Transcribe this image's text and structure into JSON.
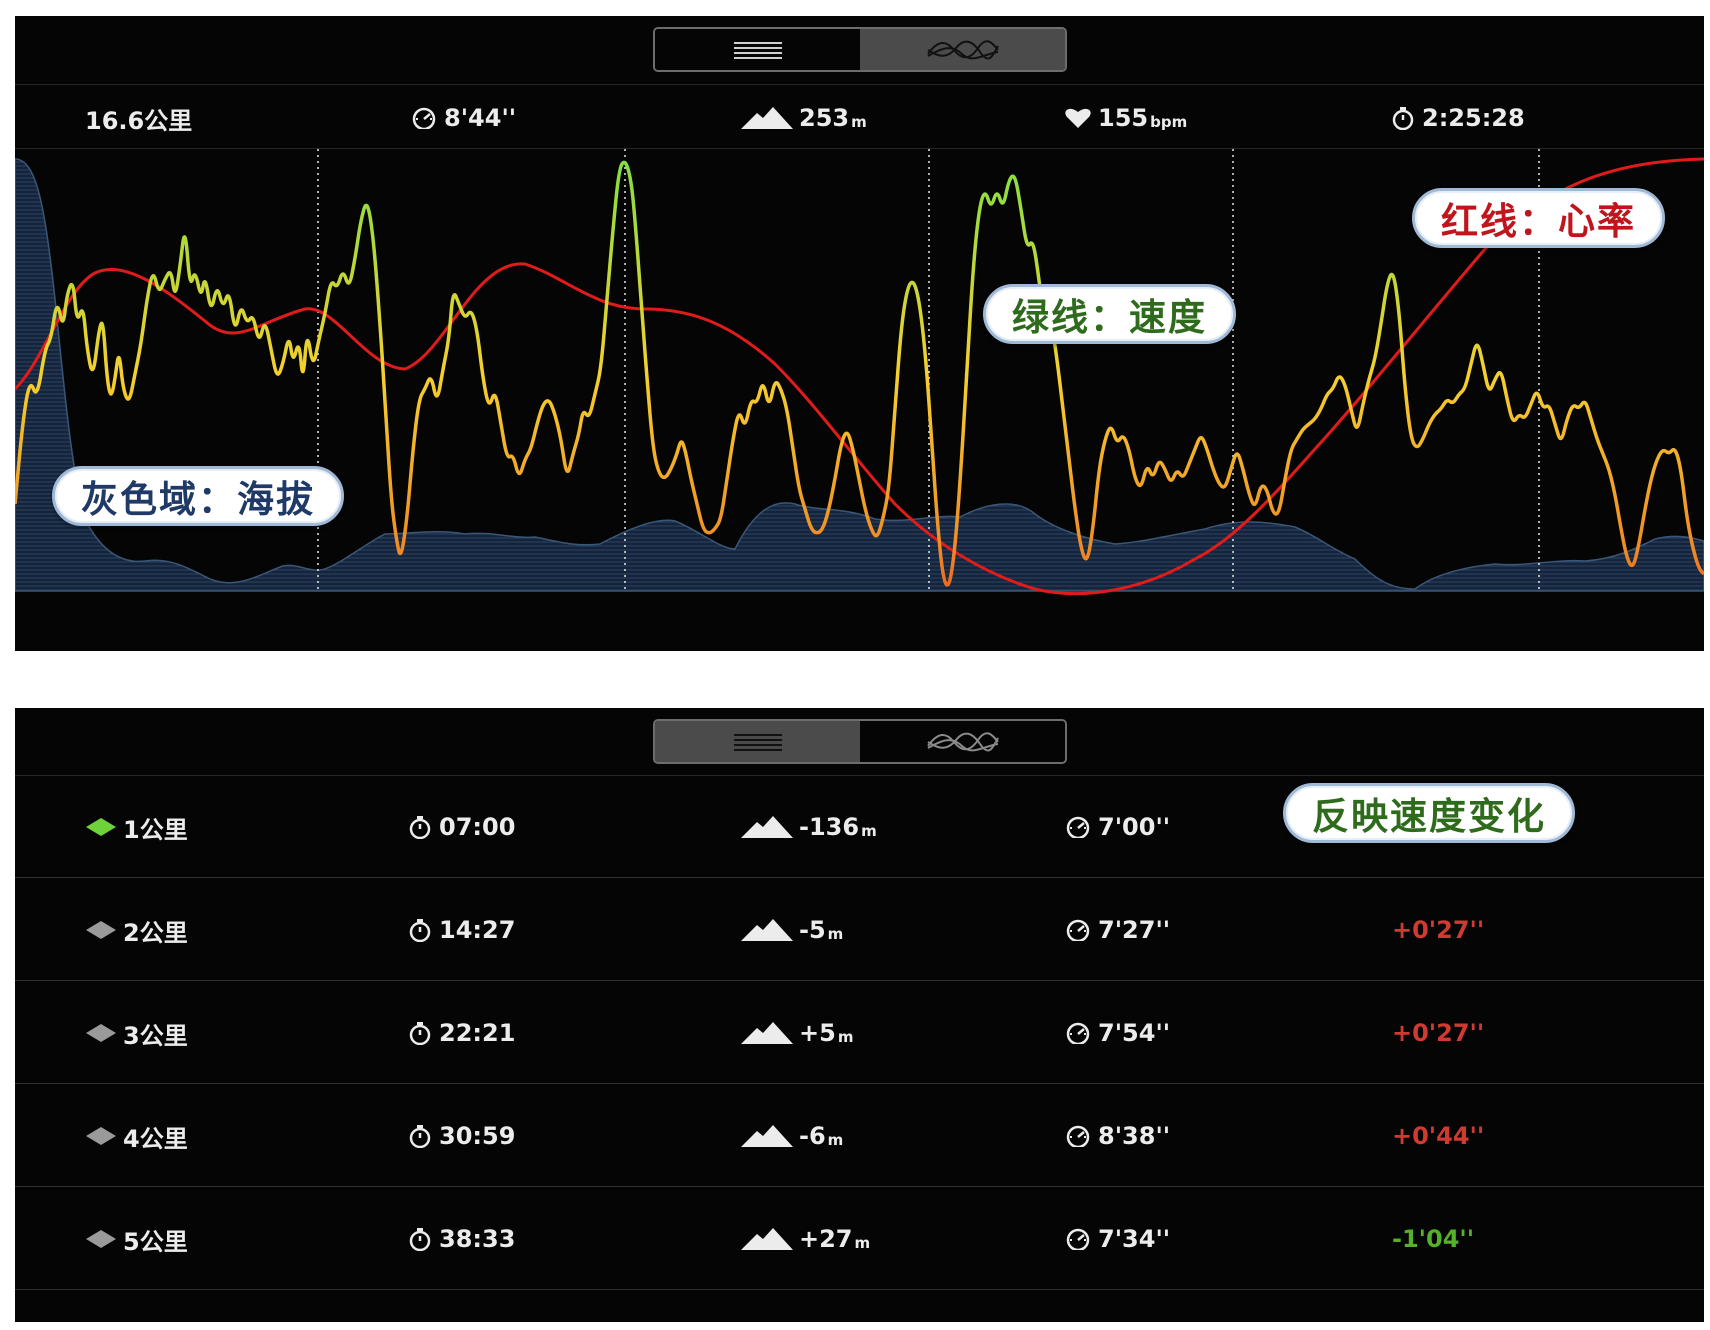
{
  "chart_panel": {
    "stats": {
      "distance": "16.6公里",
      "pace": "8'44''",
      "elevation": "253",
      "elevation_unit": "m",
      "heart_rate": "155",
      "heart_rate_unit": "bpm",
      "duration": "2:25:28"
    },
    "annotations": {
      "altitude": "灰色域：海拔",
      "speed": "绿线：速度",
      "heart_rate": "红线：心率"
    },
    "colors": {
      "heart_rate_line": "#e01b1b",
      "speed_fast": "#7ee042",
      "speed_mid": "#f5d02e",
      "speed_slow": "#e6321e",
      "altitude_fill": "#1d2d45",
      "annotation_altitude": "#1f3a66",
      "annotation_speed": "#2f6b1c",
      "annotation_heart_rate": "#c0151c"
    }
  },
  "splits_panel": {
    "annotation": "反映速度变化",
    "rows": [
      {
        "km": "1公里",
        "time": "07:00",
        "elev": "-136",
        "elev_unit": "m",
        "pace": "7'00''",
        "diff": "",
        "marker": "#6fd23a",
        "diff_color": ""
      },
      {
        "km": "2公里",
        "time": "14:27",
        "elev": "-5",
        "elev_unit": "m",
        "pace": "7'27''",
        "diff": "+0'27''",
        "marker": "#9a9a9a",
        "diff_color": "#d03a30"
      },
      {
        "km": "3公里",
        "time": "22:21",
        "elev": "+5",
        "elev_unit": "m",
        "pace": "7'54''",
        "diff": "+0'27''",
        "marker": "#9a9a9a",
        "diff_color": "#d03a30"
      },
      {
        "km": "4公里",
        "time": "30:59",
        "elev": "-6",
        "elev_unit": "m",
        "pace": "8'38''",
        "diff": "+0'44''",
        "marker": "#9a9a9a",
        "diff_color": "#d03a30"
      },
      {
        "km": "5公里",
        "time": "38:33",
        "elev": "+27",
        "elev_unit": "m",
        "pace": "7'34''",
        "diff": "-1'04''",
        "marker": "#9a9a9a",
        "diff_color": "#55b02a"
      }
    ]
  },
  "icons": {
    "list_view": "list-lines-icon",
    "graph_view": "wave-graph-icon",
    "pace": "speedometer-icon",
    "elevation": "mountain-icon",
    "heart_rate": "heart-icon",
    "duration": "stopwatch-icon",
    "split_marker": "diamond-icon"
  }
}
